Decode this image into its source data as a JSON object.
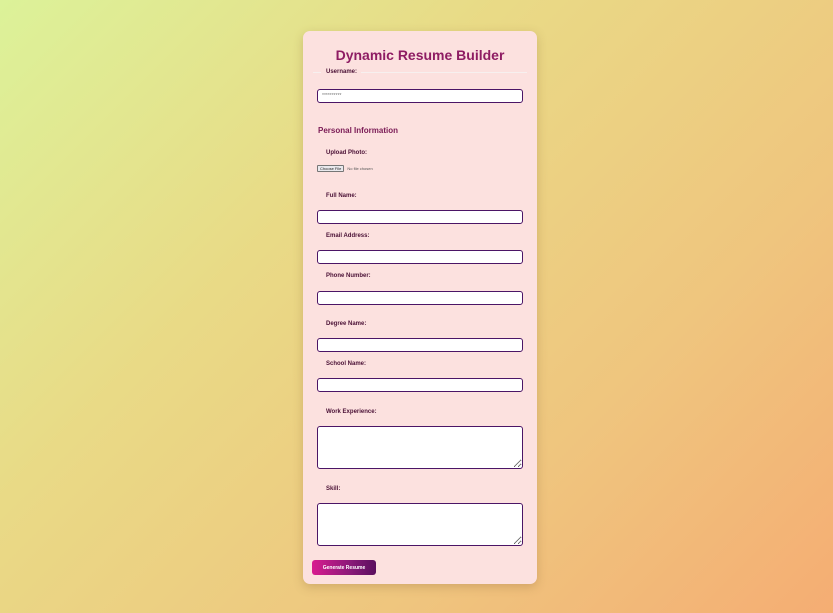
{
  "form": {
    "title": "Dynamic Resume Builder",
    "username_label": "Username:",
    "username_value": "**********",
    "section_personal": "Personal Information",
    "photo_label": "Upload Photo:",
    "photo_button": "Choose File",
    "photo_status": "No file chosen",
    "full_name_label": "Full Name:",
    "full_name_value": "",
    "email_label": "Email Address:",
    "email_value": "",
    "phone_label": "Phone Number:",
    "phone_value": "",
    "degree_label": "Degree Name:",
    "degree_value": "",
    "school_label": "School Name:",
    "school_value": "",
    "work_label": "Work Experience:",
    "work_value": "",
    "skill_label": "Skill:",
    "skill_value": "",
    "submit_label": "Generate Resume"
  },
  "colors": {
    "title": "#8e1c63",
    "card_background": "#fce1df",
    "input_border": "#4b1566",
    "button_gradient_start": "#d81b8f",
    "button_gradient_end": "#5a0e5e"
  }
}
